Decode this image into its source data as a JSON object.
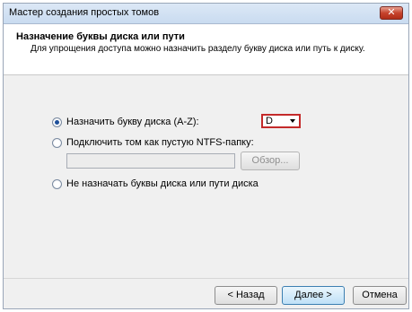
{
  "window": {
    "title": "Мастер создания простых томов",
    "close_glyph": "✕"
  },
  "header": {
    "title": "Назначение буквы диска или пути",
    "description": "Для упрощения доступа можно назначить разделу букву диска или путь к диску."
  },
  "options": {
    "assign_letter": {
      "label": "Назначить букву диска (A-Z):",
      "selected": true
    },
    "mount_folder": {
      "label": "Подключить том как пустую NTFS-папку:",
      "selected": false
    },
    "no_assign": {
      "label": "Не назначать буквы диска или пути диска",
      "selected": false
    }
  },
  "drive_letter": {
    "value": "D",
    "highlight_color": "#c42a2a"
  },
  "folder_path": {
    "value": ""
  },
  "browse_button": {
    "label": "Обзор..."
  },
  "footer": {
    "back_label": "< Назад",
    "next_label": "Далее >",
    "cancel_label": "Отмена"
  }
}
